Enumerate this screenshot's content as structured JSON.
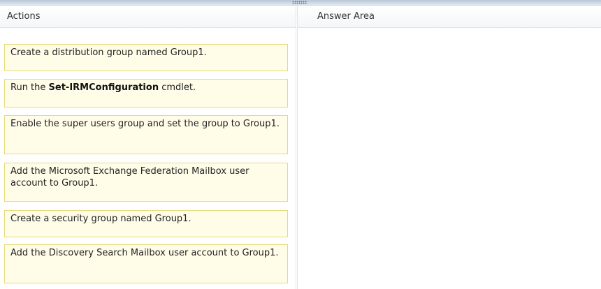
{
  "left_panel": {
    "title": "Actions"
  },
  "right_panel": {
    "title": "Answer Area"
  },
  "actions": [
    {
      "plain": "Create a distribution group named Group1."
    },
    {
      "prefix": "Run the ",
      "bold": "Set-IRMConfiguration",
      "suffix": " cmdlet."
    },
    {
      "plain": "Enable the super users group and set the group to Group1."
    },
    {
      "plain": "Add the Microsoft Exchange Federation Mailbox user account to Group1."
    },
    {
      "plain": "Create a security group named Group1."
    },
    {
      "plain": "Add the Discovery Search Mailbox user account to Group1."
    }
  ]
}
